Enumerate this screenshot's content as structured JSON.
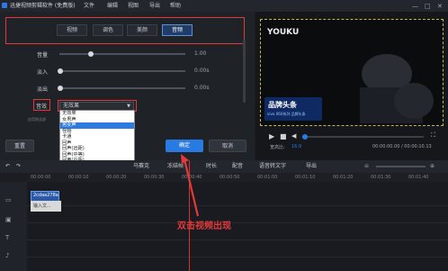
{
  "title_bar": {
    "app_title": "迅捷视频剪辑软件 (免费版)",
    "menu": [
      "文件",
      "编辑",
      "视图",
      "导出",
      "帮助"
    ],
    "window_controls": [
      "min",
      "max",
      "close"
    ]
  },
  "tabs": [
    {
      "label": "视频"
    },
    {
      "label": "调色"
    },
    {
      "label": "美颜"
    },
    {
      "label": "音频",
      "active": true
    }
  ],
  "audio": {
    "rows": [
      {
        "label": "音量",
        "value": "1.00",
        "level": 0.3
      },
      {
        "label": "淡入",
        "value": "0.00s",
        "level": 0
      },
      {
        "label": "淡出",
        "value": "0.00s",
        "level": 0
      }
    ],
    "voice_label": "音效",
    "voice_selected": "无效果",
    "options": [
      "无效果",
      "女男声",
      "女男声",
      "怪物",
      "卡通",
      "回声",
      "回声(低音)",
      "回声(中等)",
      "回声(高等)",
      "教室",
      "大厅",
      "KTV模式",
      "广播",
      "电话线",
      "电音"
    ],
    "selected_index": 3,
    "options_display": [
      "无效果",
      "女男声",
      "男女声",
      "怪物",
      "卡通",
      "回声",
      "回声(远距)",
      "回声(中等)",
      "回声(近距)",
      "室内",
      "大厅",
      "KTV模式",
      "广播",
      "电话线",
      "电音"
    ],
    "apply_all": "应用到全部"
  },
  "buttons": {
    "reset": "重置",
    "confirm": "确定",
    "cancel": "取消"
  },
  "preview": {
    "watermark": "YOUKU",
    "banner_title": "品牌头条",
    "banner_sub": "vivo X60系列 品牌头条",
    "ratio_label": "宽高比:",
    "ratio_value": "16:9",
    "time": "00:00:00.00 / 00:00:10.13"
  },
  "toolbar": {
    "items": [
      "马赛克",
      "冻结帧",
      "时长",
      "配音",
      "语音转文字",
      "导出"
    ]
  },
  "ruler": {
    "ticks": [
      "00:00:00",
      "00:00:10",
      "00:00:20",
      "00:00:30",
      "00:00:40",
      "00:00:50",
      "00:01:00",
      "00:01:10",
      "00:01:20",
      "00:01:30",
      "00:01:40"
    ]
  },
  "timeline": {
    "clip_label": "2cdaa278a",
    "text_clip": "输入文..."
  },
  "annotation": {
    "caption": "双击视频出现"
  },
  "colors": {
    "accent": "#2a7ae4",
    "highlight": "#e23a3a"
  }
}
